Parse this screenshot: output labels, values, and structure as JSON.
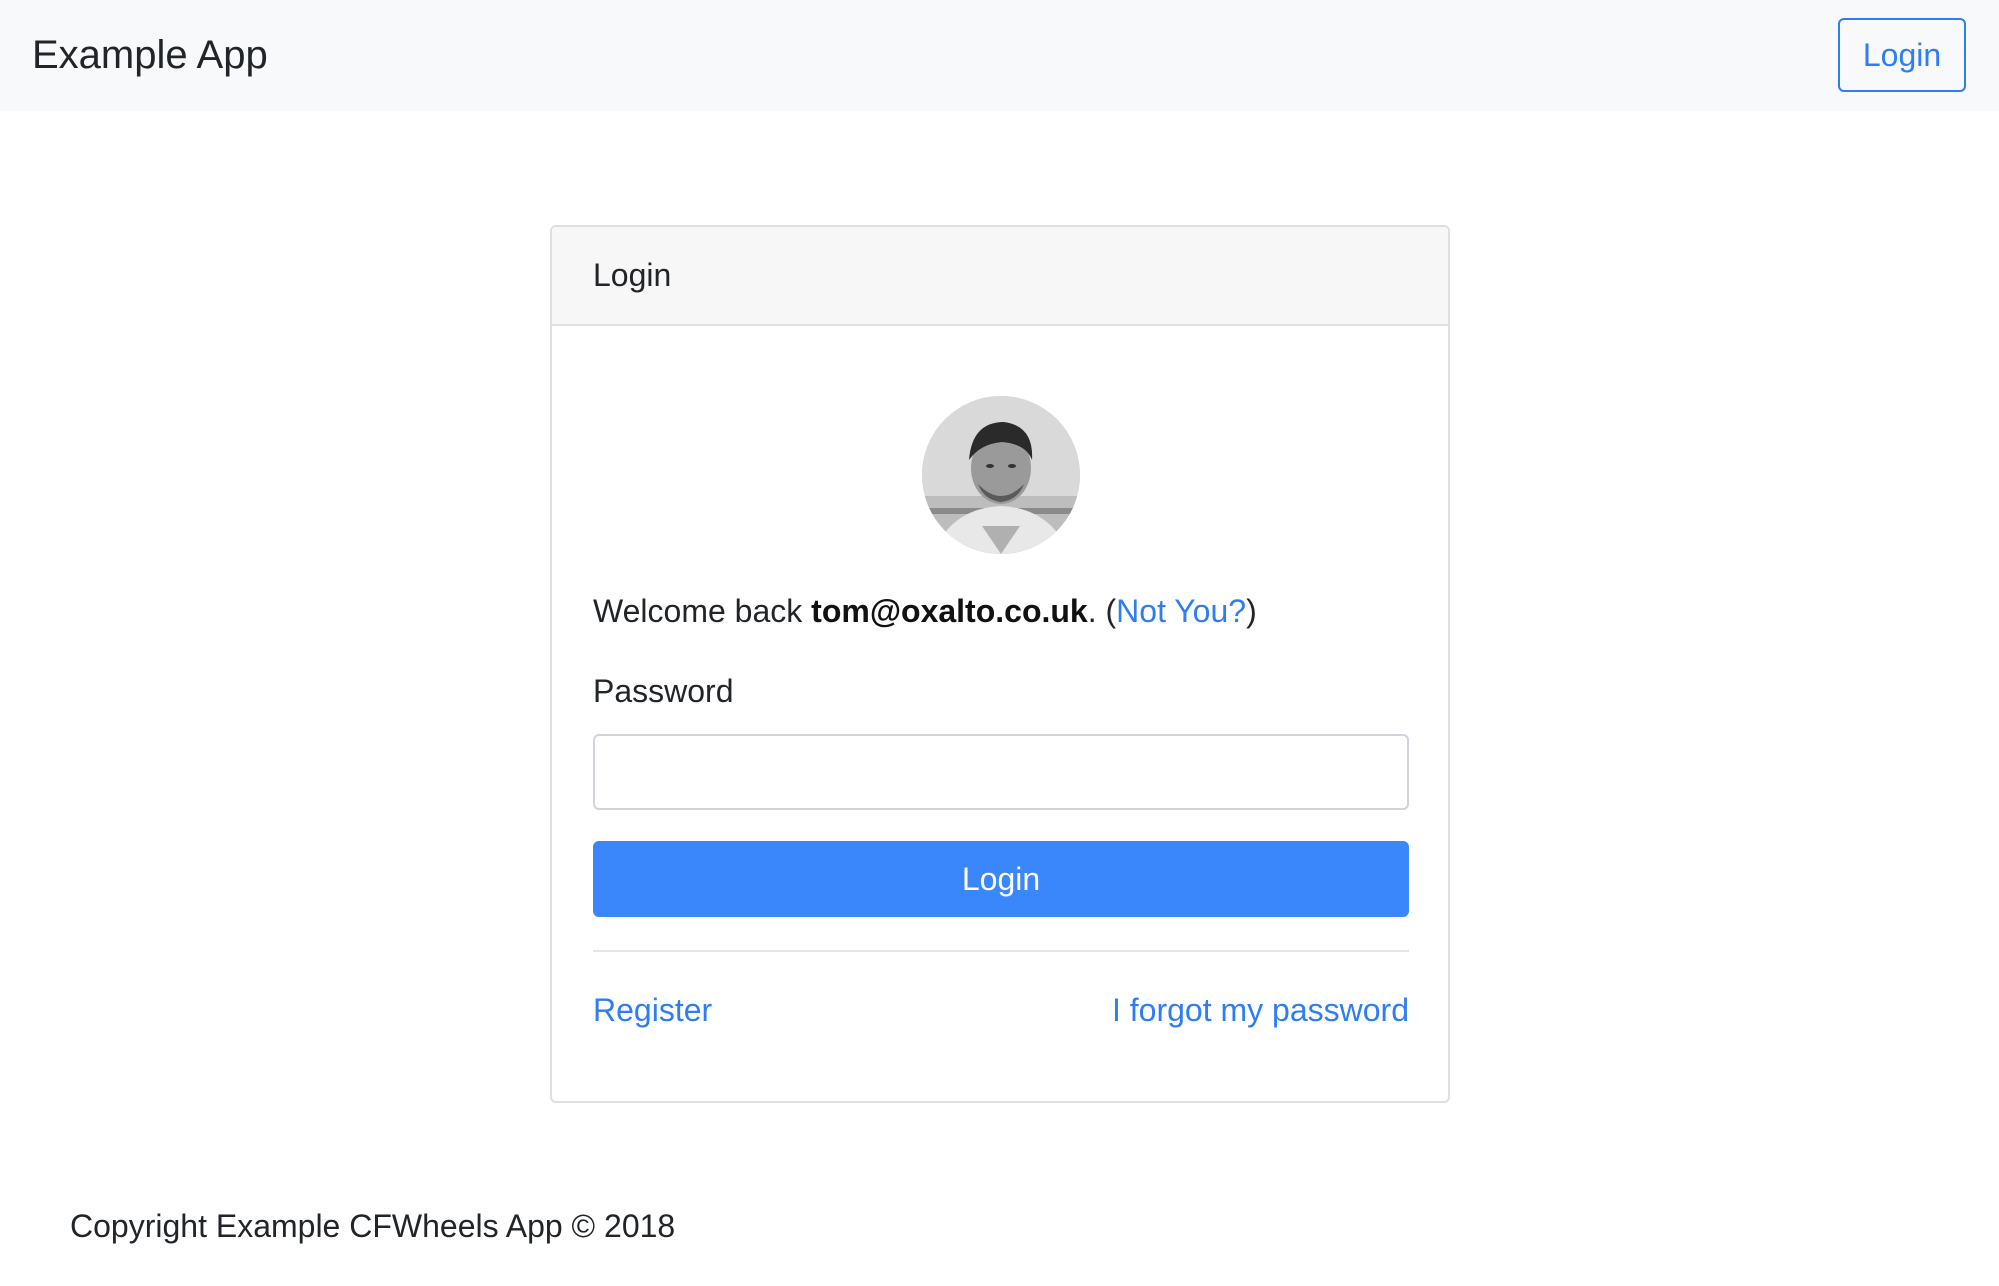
{
  "navbar": {
    "brand": "Example App",
    "login_label": "Login"
  },
  "card": {
    "title": "Login",
    "welcome_prefix": "Welcome back ",
    "email": "tom@oxalto.co.uk",
    "welcome_suffix": ". (",
    "not_you": "Not You?",
    "close_paren": ")",
    "password_label": "Password",
    "password_value": "",
    "login_button": "Login",
    "register_link": "Register",
    "forgot_link": "I forgot my password"
  },
  "footer": {
    "copyright": "Copyright Example CFWheels App © 2018"
  },
  "colors": {
    "accent": "#3a86fb",
    "link": "#2f7df5",
    "navbar_bg": "#f8f9fa",
    "card_header_bg": "#f7f7f7"
  }
}
